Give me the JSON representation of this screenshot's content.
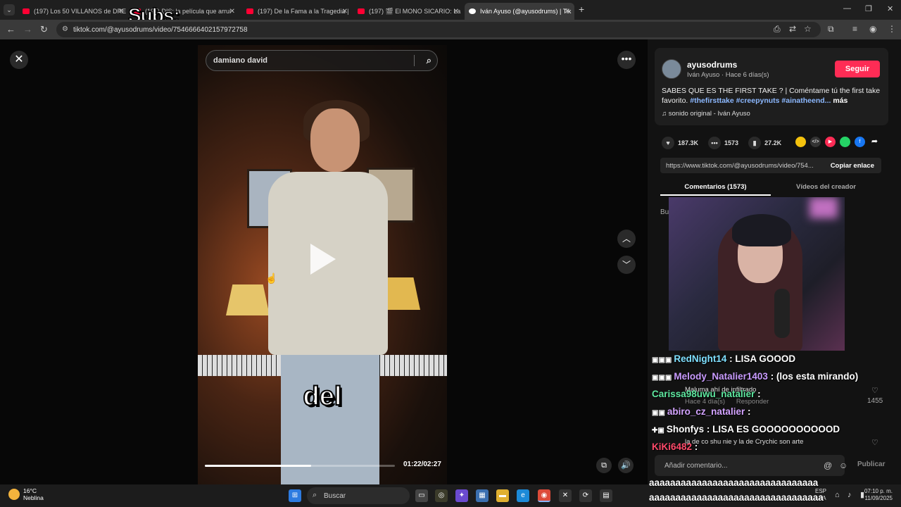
{
  "browser": {
    "tabs": [
      {
        "title": "(197) Los 50 VILLANOS de DRE",
        "type": "yt"
      },
      {
        "title": "(197) DIS: la película que arrui",
        "type": "yt"
      },
      {
        "title": "(197) De la Fama a la Tragedia |",
        "type": "yt"
      },
      {
        "title": "(197) 🎬 El MONO SICARIO: La",
        "type": "yt"
      },
      {
        "title": "Iván Ayuso (@ayusodrums) | Tik",
        "type": "tt"
      }
    ],
    "overlay_subs": "Subs:",
    "url": "tiktok.com/@ayusodrums/video/7546666402157972758"
  },
  "video": {
    "search_text": "damiano david",
    "caption": "del",
    "time": "01:22/02:27",
    "progress": 0.56
  },
  "creator": {
    "username": "ayusodrums",
    "subline": "Iván Ayuso · Hace 6 días(s)",
    "follow_label": "Seguir",
    "description_text": "SABES QUE ES THE FIRST TAKE ? | Coméntame tú the first take favorito. ",
    "description_tags": "#thefirsttake #creepynuts #ainatheend...",
    "more_label": "más",
    "sound": "sonido original - Iván Ayuso"
  },
  "stats": {
    "likes": "187.3K",
    "comments": "1573",
    "saves": "27.2K"
  },
  "link": {
    "url": "https://www.tiktok.com/@ayusodrums/video/754...",
    "copy_label": "Copiar enlace"
  },
  "side_tabs": {
    "comments": "Comentarios (1573)",
    "creator_videos": "Vídeos del creador"
  },
  "comment_fragment": "Bu",
  "chat": [
    {
      "user": "RedNight14",
      "msg": "LISA GOOOD",
      "color": "#7fe0ff"
    },
    {
      "user": "Melody_Natalier1403",
      "msg": "(los esta mirando)",
      "color": "#c99bff"
    },
    {
      "user": "Carissa98uwu_natalier",
      "msg": "",
      "color": "#5ee8a0"
    },
    {
      "user": "abiro_cz_natalier",
      "msg": "",
      "color": "#d3a3ff"
    },
    {
      "user": "Shonfys",
      "msg": "LISA ES GOOOOOOOOOOD",
      "color": "#ffffff"
    },
    {
      "user": "KiKi6482",
      "msg": "",
      "color": "#ff4a6a"
    }
  ],
  "under_comments": {
    "line1": "Maluma ahí de infiltrado",
    "line1_meta": "Hace 4 día(s)",
    "reply": "Responder",
    "likes": "1455",
    "line2": "la de co shu nie y la de Crychic son arte"
  },
  "comment_input": {
    "placeholder": "Añadir comentario...",
    "publish": "Publicar"
  },
  "spam_lines": [
    "aaaaaaaaaaaaaaaaaaaaaaaaaaaaaaaa",
    "aaaaaaaaaaaaaaaaaaaaaaaaaaaaaaaaa"
  ],
  "taskbar": {
    "temp": "16°C",
    "weather": "Neblina",
    "search": "Buscar",
    "lang1": "ESP",
    "lang2": "LAA",
    "time": "07:10 p. m.",
    "date": "11/09/2025"
  }
}
